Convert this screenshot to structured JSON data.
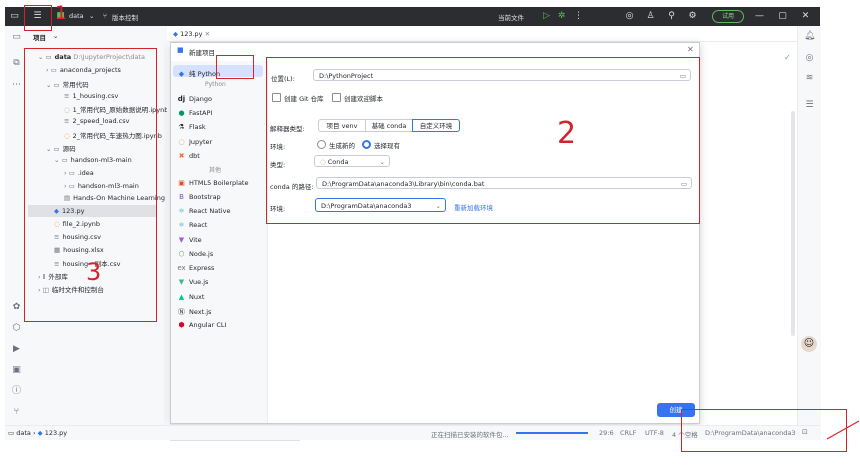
{
  "titlebar": {
    "project": "data",
    "vcs": "版本控制",
    "current_file": "当前文件",
    "try_button": "试用"
  },
  "editor_tab": {
    "name": "123.py"
  },
  "project_panel": {
    "title": "项目",
    "tree": [
      {
        "label": "data",
        "sub": "D:\\JupyterProject\\data"
      },
      {
        "label": "anaconda_projects"
      },
      {
        "label": "常用代码"
      },
      {
        "label": "1_housing.csv"
      },
      {
        "label": "1_常用代码_原始数据说明.ipynb"
      },
      {
        "label": "2_speed_load.csv"
      },
      {
        "label": "2_常用代码_车速热力图.ipynb"
      },
      {
        "label": "源码"
      },
      {
        "label": "handson-ml3-main"
      },
      {
        "label": ".idea"
      },
      {
        "label": "handson-ml3-main"
      },
      {
        "label": "Hands-On Machine Learning"
      },
      {
        "label": "123.py"
      },
      {
        "label": "file_2.ipynb"
      },
      {
        "label": "housing.csv"
      },
      {
        "label": "housing.xlsx"
      },
      {
        "label": "housing - 副本.csv"
      },
      {
        "label": "外部库"
      },
      {
        "label": "临时文件和控制台"
      }
    ]
  },
  "dialog": {
    "title": "新建项目",
    "sidebar": {
      "selected": "纯 Python",
      "group1": "Python",
      "items1": [
        "Django",
        "FastAPI",
        "Flask",
        "Jupyter",
        "dbt"
      ],
      "group2": "其他",
      "items2": [
        "HTML5 Boilerplate",
        "Bootstrap",
        "React Native",
        "React",
        "Vite",
        "Node.js",
        "Express",
        "Vue.js",
        "Nuxt",
        "Next.js",
        "Angular CLI"
      ]
    },
    "form": {
      "location_label": "位置(L):",
      "location_value": "D:\\PythonProject",
      "git_checkbox": "创建 Git 仓库",
      "welcome_checkbox": "创建欢迎脚本",
      "interpreter_label": "解释器类型:",
      "interpreter_options": [
        "项目 venv",
        "基础 conda",
        "自定义环境"
      ],
      "env_label": "环境:",
      "env_options": [
        "生成新的",
        "选择现有"
      ],
      "type_label": "类型:",
      "type_value": "Conda",
      "conda_path_label": "conda 的路径:",
      "conda_path_value": "D:\\ProgramData\\anaconda3\\Library\\bin\\conda.bat",
      "env2_label": "环境:",
      "env2_value": "D:\\ProgramData\\anaconda3",
      "reload_link": "重新加载环境"
    },
    "create_button": "创建"
  },
  "statusbar": {
    "breadcrumb_root": "data",
    "breadcrumb_file": "123.py",
    "progress_text": "正在扫描已安装的软件包...",
    "position": "29:6",
    "line_ending": "CRLF",
    "encoding": "UTF-8",
    "indent": "4 个空格",
    "interpreter": "D:\\ProgramData\\anaconda3"
  },
  "annotations": {
    "label1": "1",
    "label2": "2",
    "label3": "3"
  },
  "colors": {
    "accent": "#3574f0",
    "annotation": "#d3242b",
    "titlebar_bg": "#2b2d30"
  }
}
